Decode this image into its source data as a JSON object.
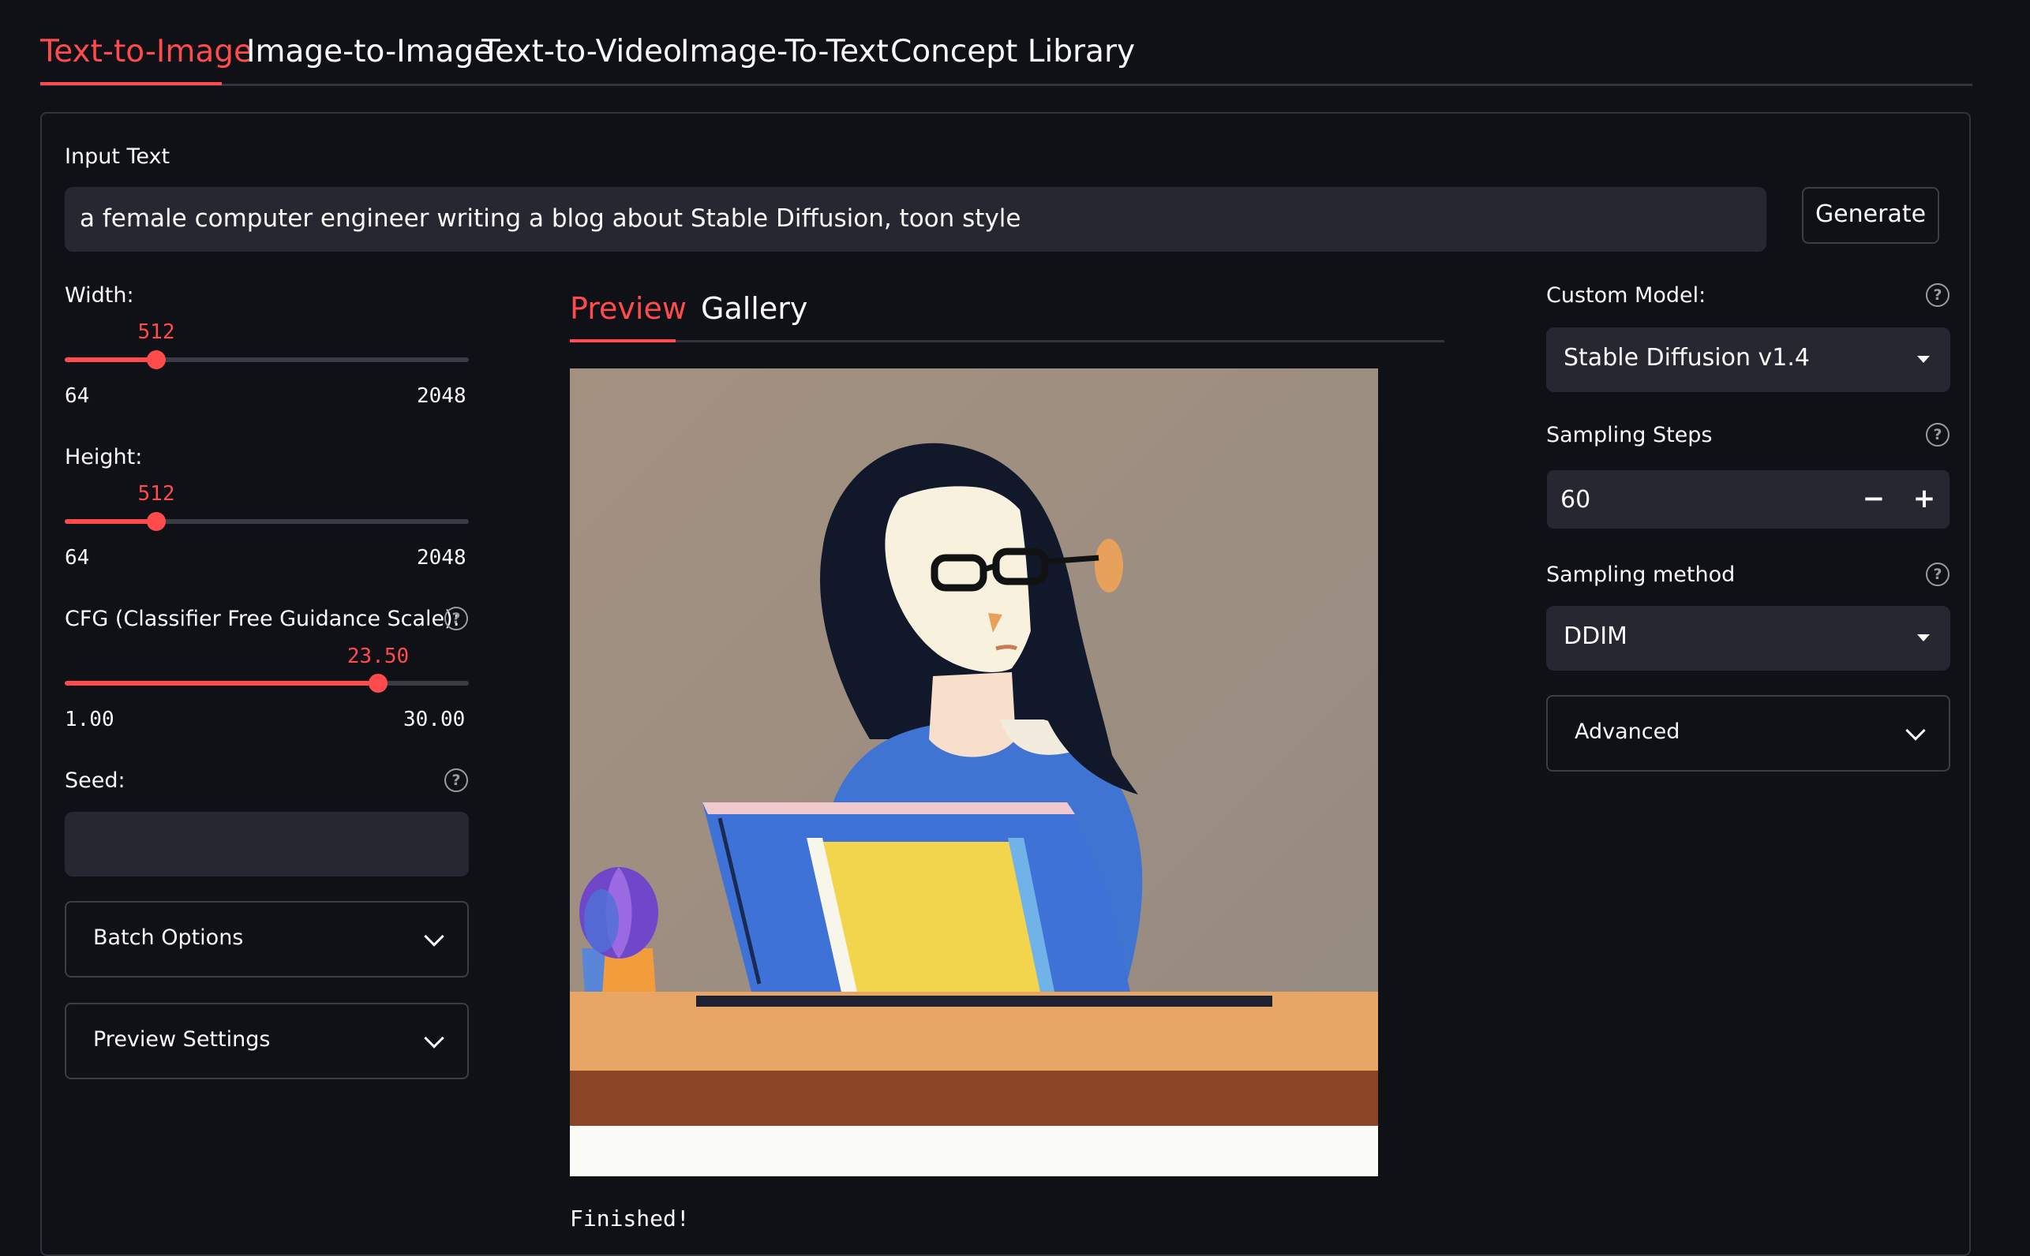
{
  "tabs": [
    "Text-to-Image",
    "Image-to-Image",
    "Text-to-Video",
    "Image-To-Text",
    "Concept Library"
  ],
  "input": {
    "label": "Input Text",
    "value": "a female computer engineer writing a blog about Stable Diffusion, toon style"
  },
  "generate_label": "Generate",
  "width": {
    "label": "Width:",
    "value": "512",
    "min": "64",
    "max": "2048",
    "fraction": 0.2258
  },
  "height": {
    "label": "Height:",
    "value": "512",
    "min": "64",
    "max": "2048",
    "fraction": 0.2258
  },
  "cfg": {
    "label": "CFG (Classifier Free Guidance Scale):",
    "value": "23.50",
    "min": "1.00",
    "max": "30.00",
    "fraction": 0.7759
  },
  "seed": {
    "label": "Seed:",
    "value": ""
  },
  "batch_options_label": "Batch Options",
  "preview_settings_label": "Preview Settings",
  "center_tabs": [
    "Preview",
    "Gallery"
  ],
  "status_text": "Finished!",
  "custom_model": {
    "label": "Custom Model:",
    "value": "Stable Diffusion v1.4"
  },
  "sampling_steps": {
    "label": "Sampling Steps",
    "value": "60"
  },
  "sampling_method": {
    "label": "Sampling method",
    "value": "DDIM"
  },
  "advanced_label": "Advanced",
  "icons": {
    "help": "?",
    "minus": "−",
    "plus": "+"
  },
  "colors": {
    "accent": "#ff4b4b",
    "background": "#0f1117",
    "input_bg": "#262730"
  }
}
